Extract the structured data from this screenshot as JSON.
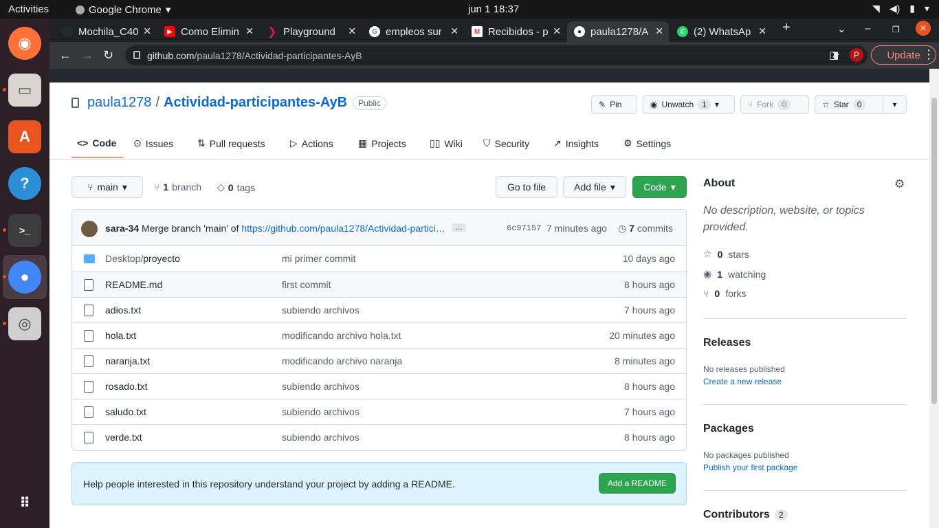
{
  "system": {
    "activities": "Activities",
    "app_name": "Google Chrome",
    "clock": "jun 1  18:37"
  },
  "tabs": [
    {
      "title": "Mochila_C40",
      "favicon": "github-icon",
      "color": "#24292f"
    },
    {
      "title": "Como Elimin",
      "favicon": "youtube-icon",
      "color": "#ff0000"
    },
    {
      "title": "Playground",
      "favicon": "playground-icon",
      "color": "#d4145a"
    },
    {
      "title": "empleos sur",
      "favicon": "google-icon",
      "color": "#4285f4"
    },
    {
      "title": "Recibidos - p",
      "favicon": "gmail-icon",
      "color": "#ea4335"
    },
    {
      "title": "paula1278/A",
      "favicon": "github-icon",
      "color": "#24292f"
    },
    {
      "title": "(2) WhatsAp",
      "favicon": "whatsapp-icon",
      "color": "#25d366"
    }
  ],
  "browser": {
    "url_host": "github.com",
    "url_path": "/paula1278/Actividad-participantes-AyB",
    "profile_initial": "P",
    "update_label": "Update"
  },
  "repo": {
    "owner": "paula1278",
    "separator": "/",
    "name": "Actividad-participantes-AyB",
    "visibility": "Public",
    "pin_label": "Pin",
    "unwatch_label": "Unwatch",
    "watch_count": "1",
    "fork_label": "Fork",
    "fork_count": "0",
    "star_label": "Star",
    "star_count": "0"
  },
  "nav": {
    "code": "Code",
    "issues": "Issues",
    "pull_requests": "Pull requests",
    "actions": "Actions",
    "projects": "Projects",
    "wiki": "Wiki",
    "security": "Security",
    "insights": "Insights",
    "settings": "Settings"
  },
  "toolbar": {
    "branch": "main",
    "branch_count": "1",
    "branch_label": "branch",
    "tag_count": "0",
    "tag_label": "tags",
    "goto_file": "Go to file",
    "add_file": "Add file",
    "code": "Code"
  },
  "commit": {
    "author": "sara-34",
    "message": "Merge branch 'main' of",
    "link": "https://github.com/paula1278/Actividad-partici…",
    "ellipsis": "…",
    "sha": "6c97157",
    "time": "7 minutes ago",
    "count": "7",
    "count_label": "commits"
  },
  "files": [
    {
      "prefix": "Desktop/",
      "name": "proyecto",
      "type": "folder",
      "message": "mi primer commit",
      "time": "10 days ago"
    },
    {
      "prefix": "",
      "name": "README.md",
      "type": "file",
      "message": "first commit",
      "time": "8 hours ago"
    },
    {
      "prefix": "",
      "name": "adios.txt",
      "type": "file",
      "message": "subiendo archivos",
      "time": "7 hours ago"
    },
    {
      "prefix": "",
      "name": "hola.txt",
      "type": "file",
      "message": "modificando archivo hola.txt",
      "time": "20 minutes ago"
    },
    {
      "prefix": "",
      "name": "naranja.txt",
      "type": "file",
      "message": "modificando archivo naranja",
      "time": "8 minutes ago"
    },
    {
      "prefix": "",
      "name": "rosado.txt",
      "type": "file",
      "message": "subiendo archivos",
      "time": "8 hours ago"
    },
    {
      "prefix": "",
      "name": "saludo.txt",
      "type": "file",
      "message": "subiendo archivos",
      "time": "7 hours ago"
    },
    {
      "prefix": "",
      "name": "verde.txt",
      "type": "file",
      "message": "subiendo archivos",
      "time": "8 hours ago"
    }
  ],
  "readme_prompt": {
    "text": "Help people interested in this repository understand your project by adding a README.",
    "button": "Add a README"
  },
  "about": {
    "title": "About",
    "description": "No description, website, or topics provided.",
    "stars_count": "0",
    "stars_label": "stars",
    "watching_count": "1",
    "watching_label": "watching",
    "forks_count": "0",
    "forks_label": "forks"
  },
  "releases": {
    "title": "Releases",
    "empty": "No releases published",
    "link": "Create a new release"
  },
  "packages": {
    "title": "Packages",
    "empty": "No packages published",
    "link": "Publish your first package"
  },
  "contributors": {
    "title": "Contributors",
    "count": "2"
  }
}
